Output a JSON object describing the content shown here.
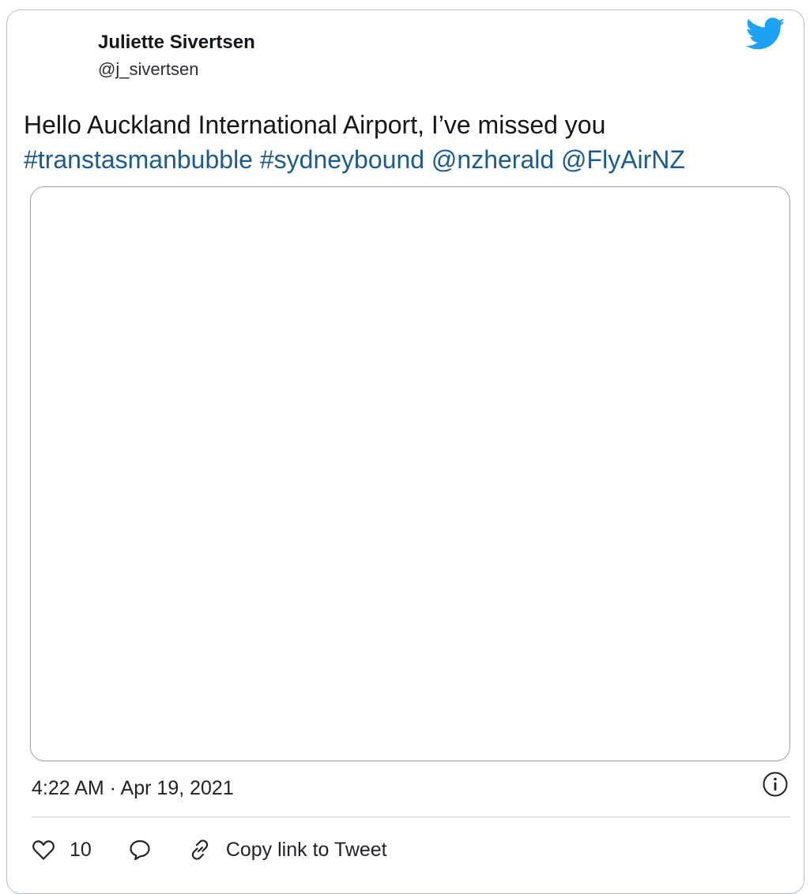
{
  "author": {
    "name": "Juliette Sivertsen",
    "handle": "@j_sivertsen"
  },
  "tweet": {
    "text_line1": "Hello Auckland International Airport, I’ve missed you",
    "hashtag1": "#transtasmanbubble",
    "hashtag2": "#sydneybound",
    "mention1": "@nzherald",
    "mention2": "@FlyAirNZ"
  },
  "meta": {
    "timestamp": "4:22 AM · Apr 19, 2021"
  },
  "actions": {
    "like_count": "10",
    "copy_link_label": "Copy link to Tweet"
  },
  "icons": {
    "brand": "twitter-bird-icon",
    "info": "info-icon",
    "like": "heart-icon",
    "reply": "speech-bubble-icon",
    "copy_link": "link-icon"
  },
  "colors": {
    "brand_blue": "#1da1f2",
    "link_blue": "#1b5a93",
    "text": "#14171a",
    "border": "#b9bec4"
  }
}
